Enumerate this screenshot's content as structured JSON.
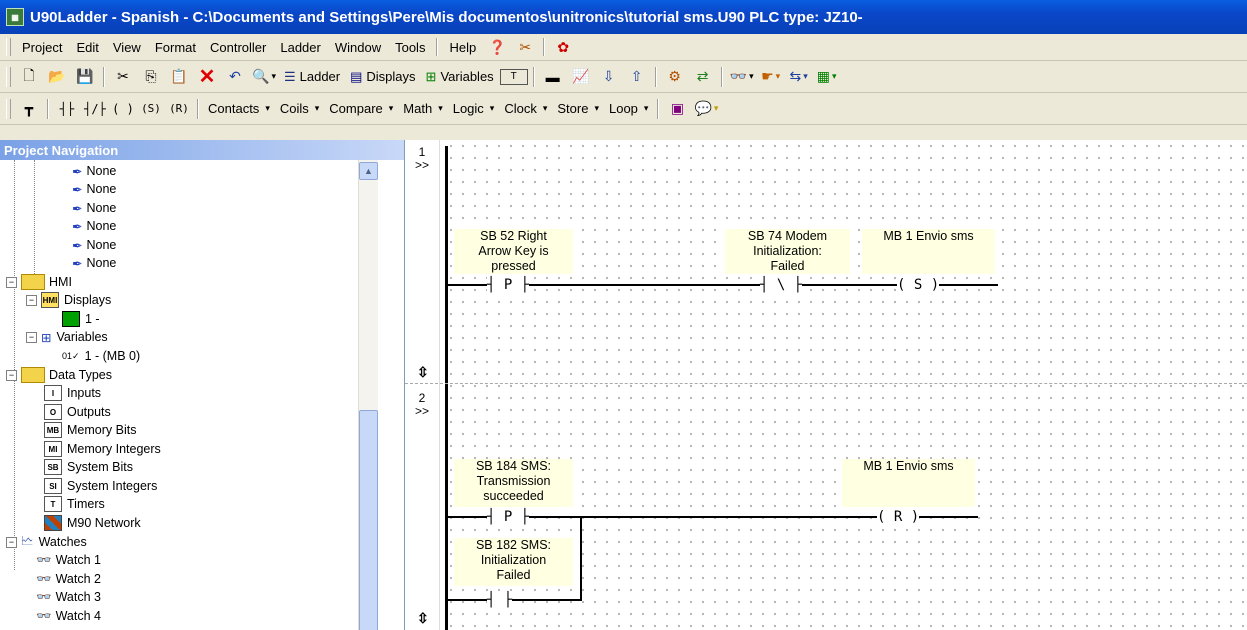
{
  "window": {
    "title": "U90Ladder - Spanish - C:\\Documents and Settings\\Pere\\Mis documentos\\unitronics\\tutorial sms.U90   PLC type: JZ10-"
  },
  "menu": [
    "Project",
    "Edit",
    "View",
    "Format",
    "Controller",
    "Ladder",
    "Window",
    "Tools",
    "Help"
  ],
  "toolbar1": {
    "ladder": "Ladder",
    "displays": "Displays",
    "variables": "Variables"
  },
  "toolbar2": {
    "contacts": "Contacts",
    "coils": "Coils",
    "compare": "Compare",
    "math": "Math",
    "logic": "Logic",
    "clock": "Clock",
    "store": "Store",
    "loop": "Loop"
  },
  "nav": {
    "header": "Project Navigation",
    "none_items": [
      "None",
      "None",
      "None",
      "None",
      "None",
      "None"
    ],
    "hmi": "HMI",
    "displays": "Displays",
    "display_1": "1 -",
    "variables": "Variables",
    "variable_1": "1 - (MB 0)",
    "data_types": "Data Types",
    "types": [
      {
        "icon": "I",
        "label": "Inputs"
      },
      {
        "icon": "O",
        "label": "Outputs"
      },
      {
        "icon": "MB",
        "label": "Memory Bits"
      },
      {
        "icon": "MI",
        "label": "Memory Integers"
      },
      {
        "icon": "SB",
        "label": "System Bits"
      },
      {
        "icon": "SI",
        "label": "System Integers"
      },
      {
        "icon": "T",
        "label": "Timers"
      },
      {
        "icon": "",
        "label": "M90 Network"
      }
    ],
    "watches": "Watches",
    "watch_items": [
      "Watch 1",
      "Watch 2",
      "Watch 3",
      "Watch 4"
    ]
  },
  "ladder": {
    "rung1": {
      "number": "1",
      "marker": ">>",
      "contact1": {
        "label": [
          "SB 52  Right",
          "Arrow Key is",
          "pressed"
        ],
        "symbol": "P"
      },
      "contact2": {
        "label": [
          "SB 74  Modem",
          "Initialization:",
          "Failed"
        ],
        "symbol": "\\"
      },
      "coil": {
        "label": "MB 1  Envio sms",
        "symbol": "S"
      }
    },
    "rung2": {
      "number": "2",
      "marker": ">>",
      "contact1": {
        "label": [
          "SB 184  SMS:",
          "Transmission",
          "succeeded"
        ],
        "symbol": "P"
      },
      "contact2": {
        "label": [
          "SB 182  SMS:",
          "Initialization",
          "Failed"
        ]
      },
      "coil": {
        "label": "MB 1  Envio sms",
        "symbol": "R"
      }
    }
  }
}
